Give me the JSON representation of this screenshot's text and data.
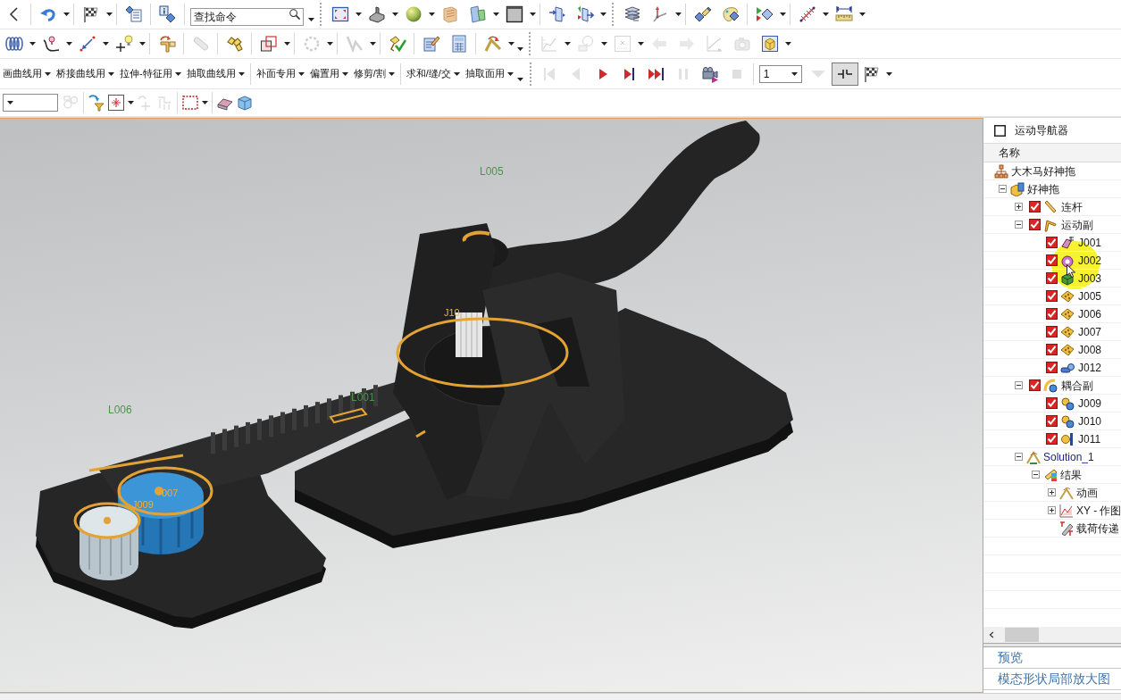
{
  "toolbars": [
    {
      "items": [
        {
          "kind": "button",
          "disabled": false
        },
        {
          "kind": "separator"
        },
        {
          "kind": "split",
          "disabled": false
        },
        {
          "kind": "separator"
        },
        {
          "kind": "split",
          "disabled": false
        },
        {
          "kind": "separator"
        },
        {
          "kind": "button",
          "disabled": false
        },
        {
          "kind": "separator"
        },
        {
          "kind": "button",
          "disabled": false
        },
        {
          "kind": "separator"
        },
        {
          "kind": "search",
          "placeholder": "查找命令"
        },
        {
          "kind": "caret"
        },
        {
          "kind": "grip"
        },
        {
          "kind": "split",
          "disabled": false
        },
        {
          "kind": "split",
          "disabled": false
        },
        {
          "kind": "split",
          "disabled": false
        },
        {
          "kind": "button",
          "disabled": false
        },
        {
          "kind": "split",
          "disabled": false
        },
        {
          "kind": "split",
          "disabled": false
        },
        {
          "kind": "separator"
        },
        {
          "kind": "button",
          "disabled": false
        },
        {
          "kind": "split",
          "disabled": false
        },
        {
          "kind": "grip"
        },
        {
          "kind": "button",
          "disabled": false
        },
        {
          "kind": "split",
          "disabled": false
        },
        {
          "kind": "separator"
        },
        {
          "kind": "button",
          "disabled": false
        },
        {
          "kind": "button",
          "disabled": false
        },
        {
          "kind": "separator"
        },
        {
          "kind": "split",
          "disabled": false
        },
        {
          "kind": "separator"
        },
        {
          "kind": "split",
          "disabled": false
        },
        {
          "kind": "split",
          "disabled": false
        }
      ]
    },
    {
      "items": [
        {
          "kind": "split",
          "disabled": false
        },
        {
          "kind": "split",
          "disabled": false
        },
        {
          "kind": "split",
          "disabled": false
        },
        {
          "kind": "split",
          "disabled": false
        },
        {
          "kind": "separator"
        },
        {
          "kind": "button",
          "disabled": false
        },
        {
          "kind": "separator"
        },
        {
          "kind": "button",
          "disabled": true
        },
        {
          "kind": "separator"
        },
        {
          "kind": "button",
          "disabled": false
        },
        {
          "kind": "separator"
        },
        {
          "kind": "split",
          "disabled": false
        },
        {
          "kind": "separator"
        },
        {
          "kind": "split",
          "disabled": true
        },
        {
          "kind": "separator"
        },
        {
          "kind": "split",
          "disabled": true
        },
        {
          "kind": "separator"
        },
        {
          "kind": "button",
          "disabled": false
        },
        {
          "kind": "separator"
        },
        {
          "kind": "button",
          "disabled": false
        },
        {
          "kind": "button",
          "disabled": false
        },
        {
          "kind": "separator"
        },
        {
          "kind": "split",
          "disabled": false
        },
        {
          "kind": "caret"
        },
        {
          "kind": "grip"
        },
        {
          "kind": "split",
          "disabled": true
        },
        {
          "kind": "split",
          "disabled": true
        },
        {
          "kind": "split",
          "disabled": true
        },
        {
          "kind": "button",
          "disabled": true
        },
        {
          "kind": "button",
          "disabled": true
        },
        {
          "kind": "button",
          "disabled": true
        },
        {
          "kind": "button",
          "disabled": true
        },
        {
          "kind": "split",
          "disabled": false
        }
      ]
    },
    {
      "items": [
        {
          "kind": "menu",
          "label": "画曲线用"
        },
        {
          "kind": "menu",
          "label": "桥接曲线用"
        },
        {
          "kind": "menu",
          "label": "拉伸-特征用"
        },
        {
          "kind": "menu",
          "label": "抽取曲线用"
        },
        {
          "kind": "separator"
        },
        {
          "kind": "menu",
          "label": "补面专用"
        },
        {
          "kind": "menu",
          "label": "偏置用"
        },
        {
          "kind": "menu",
          "label": "修剪/割"
        },
        {
          "kind": "separator"
        },
        {
          "kind": "menu",
          "label": "求和/缝/交"
        },
        {
          "kind": "menu",
          "label": "抽取面用"
        },
        {
          "kind": "caret"
        },
        {
          "kind": "grip"
        },
        {
          "kind": "button",
          "disabled": true
        },
        {
          "kind": "button",
          "disabled": true
        },
        {
          "kind": "button",
          "disabled": false
        },
        {
          "kind": "button",
          "disabled": false
        },
        {
          "kind": "button",
          "disabled": false
        },
        {
          "kind": "button",
          "disabled": true
        },
        {
          "kind": "button",
          "disabled": false
        },
        {
          "kind": "button",
          "disabled": true
        },
        {
          "kind": "separator"
        },
        {
          "kind": "select",
          "value": "1"
        },
        {
          "kind": "button",
          "disabled": true
        },
        {
          "kind": "toggle",
          "disabled": false,
          "on": true
        },
        {
          "kind": "split",
          "disabled": false
        }
      ]
    },
    {
      "items": [
        {
          "kind": "select"
        },
        {
          "kind": "button",
          "disabled": true
        },
        {
          "kind": "separator"
        },
        {
          "kind": "button",
          "disabled": false
        },
        {
          "kind": "split",
          "disabled": false
        },
        {
          "kind": "button",
          "disabled": true
        },
        {
          "kind": "button",
          "disabled": true
        },
        {
          "kind": "separator"
        },
        {
          "kind": "split",
          "disabled": false
        },
        {
          "kind": "separator"
        },
        {
          "kind": "button",
          "disabled": false
        },
        {
          "kind": "button",
          "disabled": false
        }
      ]
    }
  ],
  "viewport": {
    "link_labels": [
      "L005",
      "L006",
      "L001"
    ],
    "joint_labels": [
      "J10",
      "007",
      "J009"
    ]
  },
  "navigator": {
    "title": "运动导航器",
    "column": "名称",
    "tree": [
      {
        "label": "大木马好神拖",
        "active": false,
        "children": [
          {
            "label": "好神拖",
            "active": false,
            "expanded": true,
            "children": [
              {
                "label": "连杆",
                "checked": true,
                "active": false,
                "expanded": false
              },
              {
                "label": "运动副",
                "checked": true,
                "active": false,
                "expanded": true,
                "children": [
                  {
                    "label": "J001",
                    "checked": true,
                    "active": false
                  },
                  {
                    "label": "J002",
                    "checked": true,
                    "active": false
                  },
                  {
                    "label": "J003",
                    "checked": true,
                    "active": false
                  },
                  {
                    "label": "J005",
                    "checked": true,
                    "active": false
                  },
                  {
                    "label": "J006",
                    "checked": true,
                    "active": false
                  },
                  {
                    "label": "J007",
                    "checked": true,
                    "active": false
                  },
                  {
                    "label": "J008",
                    "checked": true,
                    "active": false
                  },
                  {
                    "label": "J012",
                    "checked": true,
                    "active": false
                  }
                ]
              },
              {
                "label": "耦合副",
                "checked": true,
                "active": false,
                "expanded": true,
                "children": [
                  {
                    "label": "J009",
                    "checked": true,
                    "active": false
                  },
                  {
                    "label": "J010",
                    "checked": true,
                    "active": false
                  },
                  {
                    "label": "J011",
                    "checked": true,
                    "active": false
                  }
                ]
              },
              {
                "label": "Solution_1",
                "active": true,
                "expanded": true,
                "children": [
                  {
                    "label": "结果",
                    "active": false,
                    "expanded": true,
                    "children": [
                      {
                        "label": "动画",
                        "active": false,
                        "expanded": false
                      },
                      {
                        "label": "XY - 作图",
                        "active": false,
                        "expanded": false
                      },
                      {
                        "label": "载荷传递",
                        "active": false
                      }
                    ]
                  }
                ]
              }
            ]
          }
        ]
      }
    ],
    "sections": [
      "预览",
      "模态形状局部放大图"
    ]
  }
}
